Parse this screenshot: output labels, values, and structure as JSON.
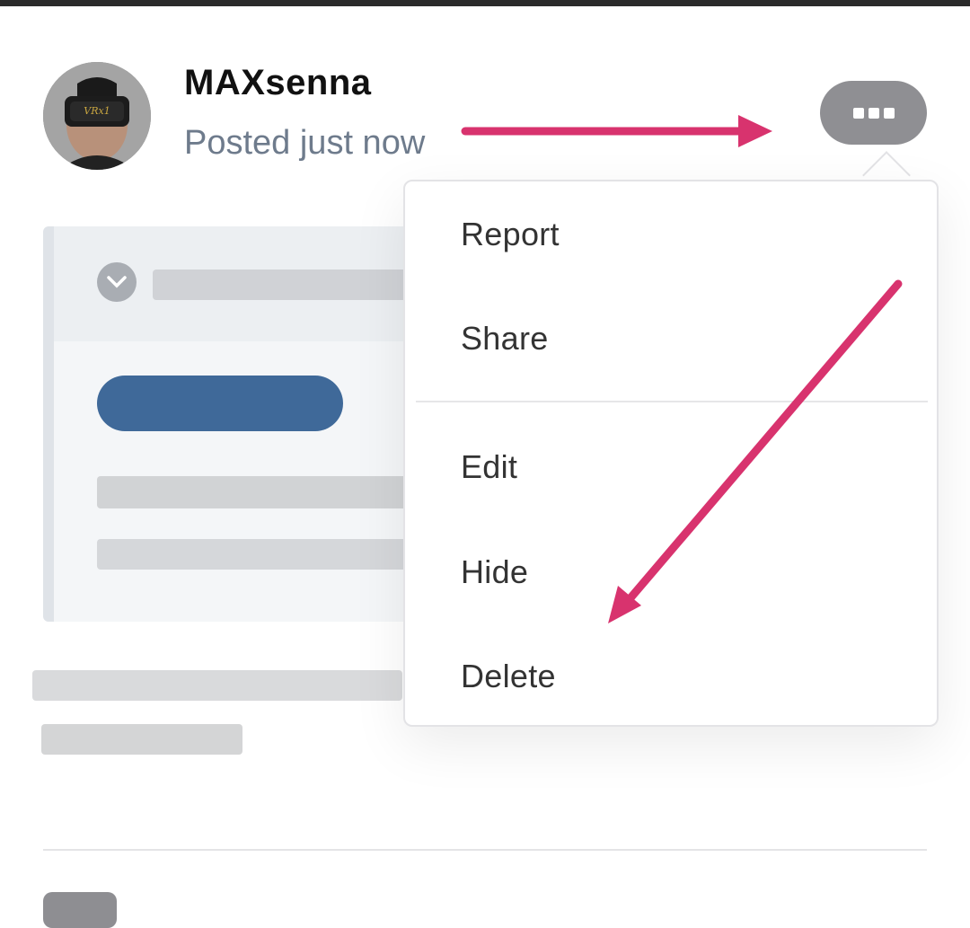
{
  "post": {
    "author": "MAXsenna",
    "posted_time": "Posted just now"
  },
  "menu": {
    "items": [
      {
        "label": "Report"
      },
      {
        "label": "Share"
      },
      {
        "label": "Edit"
      },
      {
        "label": "Hide"
      },
      {
        "label": "Delete"
      }
    ]
  },
  "icons": {
    "more": "more-options-icon",
    "expand": "chevron-down-icon"
  },
  "colors": {
    "annotation_arrow": "#d8336e",
    "more_button": "#8f8f93",
    "pill_blue": "#3f6999",
    "subtext": "#6e7b8c"
  }
}
